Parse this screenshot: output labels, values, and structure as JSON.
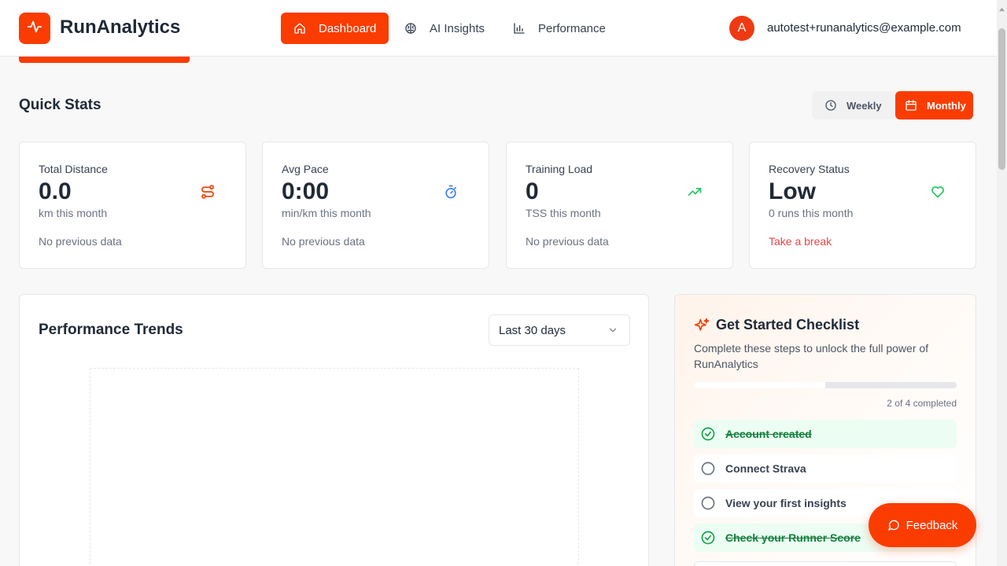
{
  "app": {
    "name": "RunAnalytics"
  },
  "nav": {
    "items": [
      {
        "label": "Dashboard",
        "icon": "home-icon",
        "active": true
      },
      {
        "label": "AI Insights",
        "icon": "brain-icon",
        "active": false
      },
      {
        "label": "Performance",
        "icon": "bar-chart-icon",
        "active": false
      }
    ]
  },
  "user": {
    "initial": "A",
    "email": "autotest+runanalytics@example.com"
  },
  "quick_stats": {
    "title": "Quick Stats",
    "period_options": [
      {
        "label": "Weekly",
        "icon": "clock-icon",
        "active": false
      },
      {
        "label": "Monthly",
        "icon": "calendar-icon",
        "active": true
      }
    ],
    "cards": [
      {
        "label": "Total Distance",
        "value": "0.0",
        "sub": "km this month",
        "note": "No previous data",
        "icon": "route-icon",
        "icon_color": "#fb3c00"
      },
      {
        "label": "Avg Pace",
        "value": "0:00",
        "sub": "min/km this month",
        "note": "No previous data",
        "icon": "stopwatch-icon",
        "icon_color": "#3b82f6"
      },
      {
        "label": "Training Load",
        "value": "0",
        "sub": "TSS this month",
        "note": "No previous data",
        "icon": "trending-up-icon",
        "icon_color": "#22c55e"
      },
      {
        "label": "Recovery Status",
        "value": "Low",
        "sub": "0 runs this month",
        "note": "Take a break",
        "icon": "heart-icon",
        "icon_color": "#22c55e"
      }
    ]
  },
  "trends": {
    "title": "Performance Trends",
    "range": "Last 30 days"
  },
  "checklist": {
    "title": "Get Started Checklist",
    "description": "Complete these steps to unlock the full power of RunAnalytics",
    "progress_fraction": 0.5,
    "progress_text": "2 of 4 completed",
    "items": [
      {
        "label": "Account created",
        "done": true
      },
      {
        "label": "Connect Strava",
        "done": false
      },
      {
        "label": "View your first insights",
        "done": false
      },
      {
        "label": "Check your Runner Score",
        "done": true
      }
    ]
  },
  "feedback": {
    "label": "Feedback"
  },
  "colors": {
    "accent": "#fb3c00",
    "success": "#15803d",
    "warning": "#ef4444"
  }
}
